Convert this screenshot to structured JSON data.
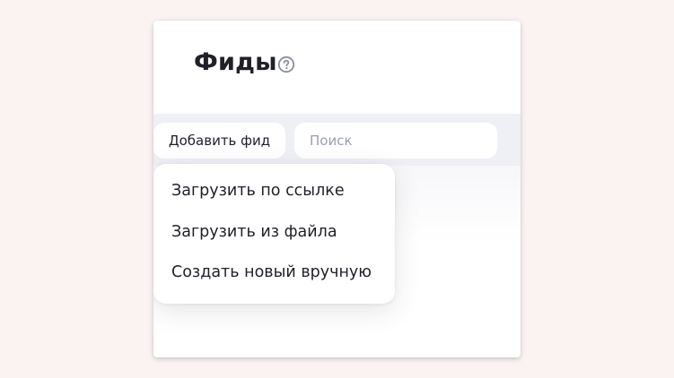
{
  "header": {
    "title": "Фиды"
  },
  "toolbar": {
    "add_feed_label": "Добавить фид",
    "search_placeholder": "Поиск"
  },
  "add_feed_menu": {
    "items": [
      {
        "label": "Загрузить по ссылке"
      },
      {
        "label": "Загрузить из файла"
      },
      {
        "label": "Создать новый вручную"
      }
    ]
  },
  "icons": {
    "help": "question-circle-icon"
  },
  "colors": {
    "page_background": "#faf3f2",
    "toolbar_background": "#eef0f5",
    "text_primary": "#1f2028",
    "placeholder": "#9aa0ab",
    "help_icon": "#8a8f99"
  }
}
